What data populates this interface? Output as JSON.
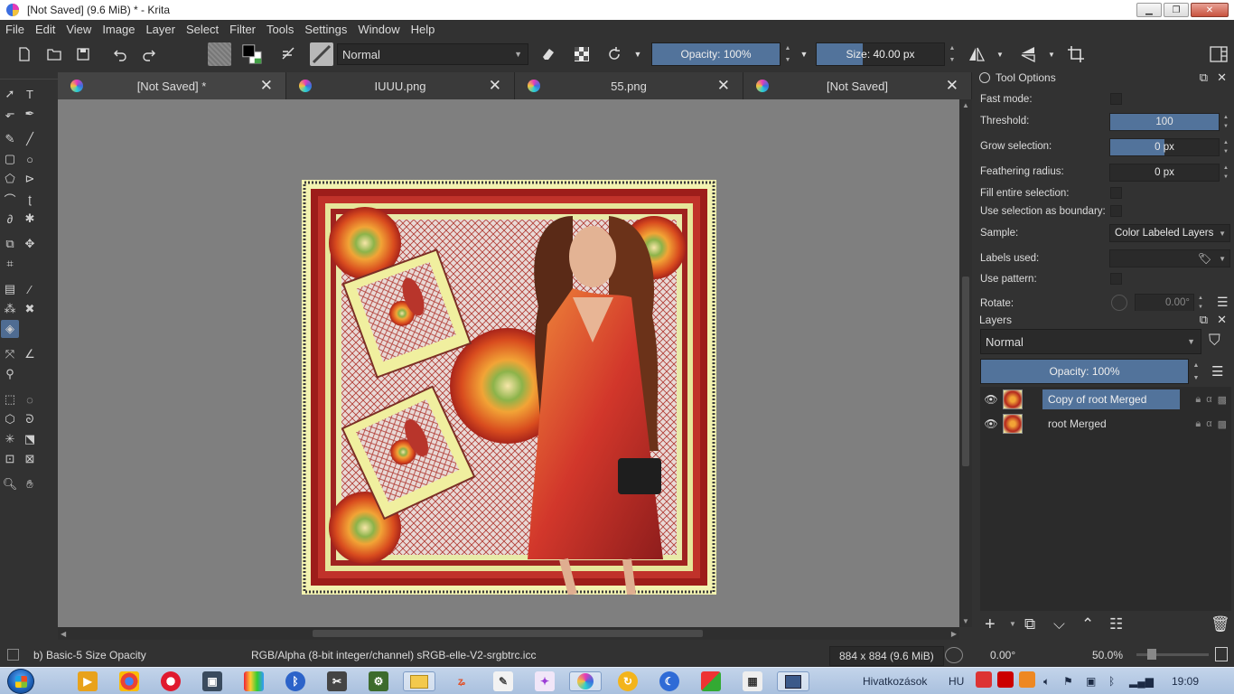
{
  "window": {
    "title": "[Not Saved]  (9.6 MiB)  * - Krita",
    "minimize": "▁",
    "restore": "❐",
    "close": "✕"
  },
  "menu": [
    "File",
    "Edit",
    "View",
    "Image",
    "Layer",
    "Select",
    "Filter",
    "Tools",
    "Settings",
    "Window",
    "Help"
  ],
  "toolbar": {
    "blend_mode": "Normal",
    "opacity_label": "Opacity: 100%",
    "opacity_value": 1.0,
    "size_label": "Size: 40.00 px",
    "size_fill": 0.36,
    "colors": {
      "foreground": "#000000",
      "background": "#ffffff",
      "accent": "#52739b"
    }
  },
  "tabs": [
    {
      "label": "[Not Saved]  *"
    },
    {
      "label": "IUUU.png"
    },
    {
      "label": "55.png"
    },
    {
      "label": "[Not Saved]"
    }
  ],
  "tool_options": {
    "title": "Tool Options",
    "rows": {
      "fast_mode": "Fast mode:",
      "threshold": "Threshold:",
      "grow_selection": "Grow selection:",
      "feathering_radius": "Feathering radius:",
      "fill_entire": "Fill entire selection:",
      "use_selection_boundary": "Use selection as boundary:",
      "sample": "Sample:",
      "labels_used": "Labels used:",
      "use_pattern": "Use pattern:",
      "rotate": "Rotate:"
    },
    "values": {
      "threshold": "100",
      "grow_selection": "0 px",
      "feathering_radius": "0 px",
      "sample": "Color Labeled Layers",
      "rotate": "0.00°"
    }
  },
  "layers": {
    "title": "Layers",
    "blend_mode": "Normal",
    "opacity_label": "Opacity:  100%",
    "items": [
      {
        "name": "Copy of root Merged",
        "selected": true
      },
      {
        "name": "root Merged",
        "selected": false
      }
    ]
  },
  "status": {
    "brush": "b) Basic-5 Size Opacity",
    "color_space": "RGB/Alpha (8-bit integer/channel)  sRGB-elle-V2-srgbtrc.icc",
    "dimensions": "884 x 884 (9.6 MiB)",
    "rotation": "0.00°",
    "zoom": "50.0%"
  },
  "taskbar": {
    "links_label": "Hivatkozások",
    "lang": "HU",
    "clock": "19:09"
  },
  "icons": {
    "new": "new-document-icon",
    "open": "open-icon",
    "save": "save-icon",
    "undo": "undo-icon",
    "redo": "redo-icon"
  }
}
